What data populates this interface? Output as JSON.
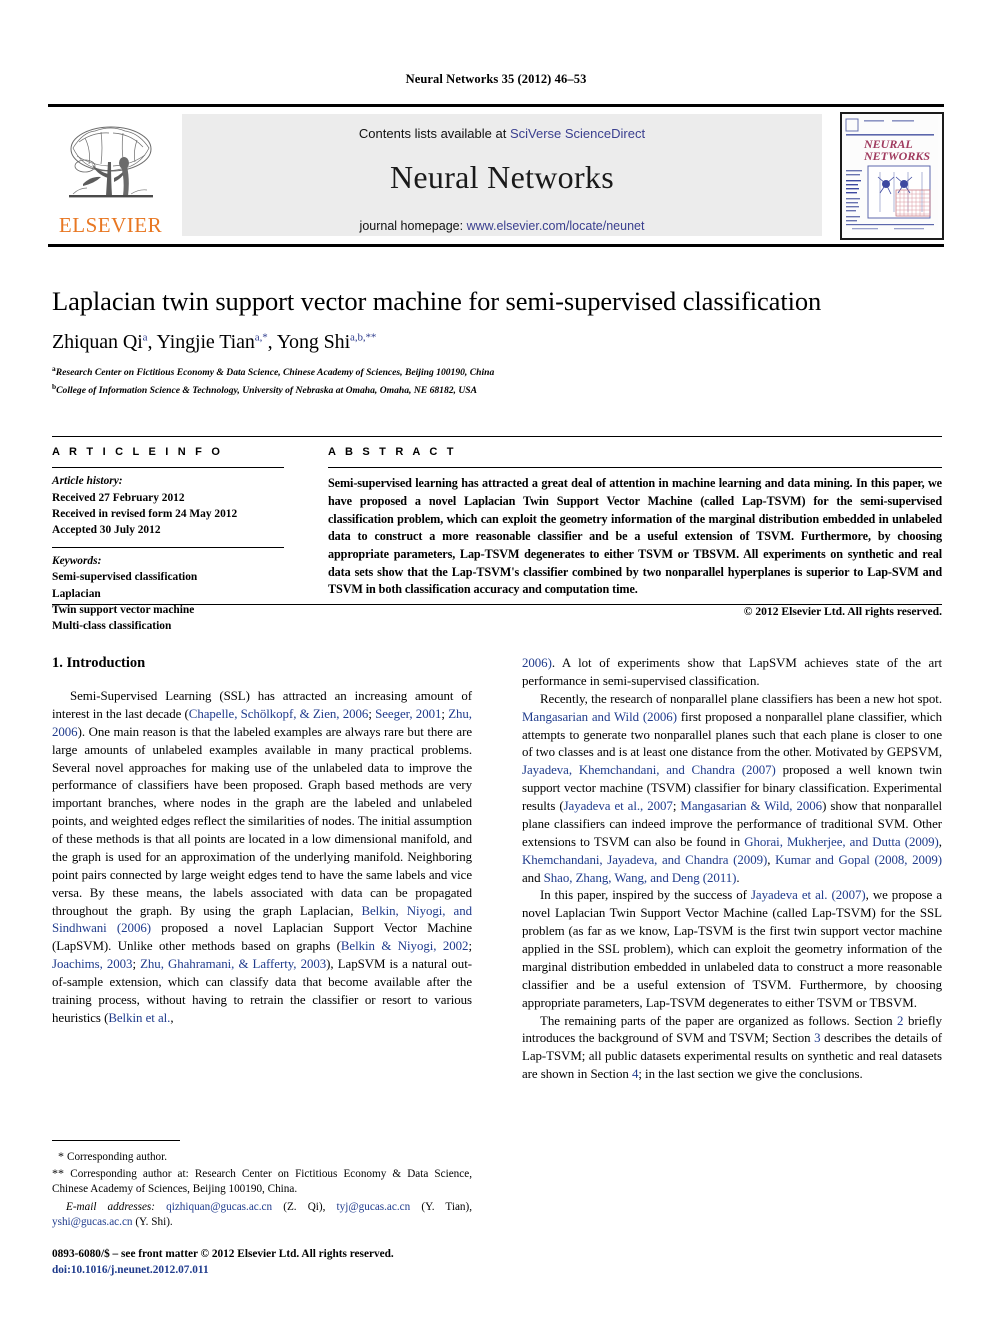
{
  "running_head": "Neural Networks 35 (2012) 46–53",
  "masthead": {
    "contents_prefix": "Contents lists available at ",
    "contents_link": "SciVerse ScienceDirect",
    "journal_name": "Neural Networks",
    "homepage_prefix": "journal homepage: ",
    "homepage_link": "www.elsevier.com/locate/neunet",
    "publisher_wordmark": "ELSEVIER",
    "cover_title_line1": "NEURAL",
    "cover_title_line2": "NETWORKS",
    "link_color": "#3a3f8f",
    "publisher_color": "#E87722"
  },
  "title": "Laplacian twin support vector machine for semi-supervised classification",
  "authors": [
    {
      "name": "Zhiquan Qi",
      "marks": "a"
    },
    {
      "name": "Yingjie Tian",
      "marks": "a,*"
    },
    {
      "name": "Yong Shi",
      "marks": "a,b,**"
    }
  ],
  "authors_line": "Zhiquan Qi",
  "affiliations": [
    {
      "mark": "a",
      "text": "Research Center on Fictitious Economy & Data Science, Chinese Academy of Sciences, Beijing 100190, China"
    },
    {
      "mark": "b",
      "text": "College of Information Science & Technology, University of Nebraska at Omaha, Omaha, NE 68182, USA"
    }
  ],
  "article_info": {
    "heading": "A R T I C L E    I N F O",
    "history_label": "Article history:",
    "history": [
      "Received 27 February 2012",
      "Received in revised form 24 May 2012",
      "Accepted 30 July 2012"
    ],
    "keywords_label": "Keywords:",
    "keywords": [
      "Semi-supervised classification",
      "Laplacian",
      "Twin support vector machine",
      "Multi-class classification"
    ]
  },
  "abstract": {
    "heading": "A B S T R A C T",
    "text": "Semi-supervised learning has attracted a great deal of attention in machine learning and data mining. In this paper, we have proposed a novel Laplacian Twin Support Vector Machine (called Lap-TSVM) for the semi-supervised classification problem, which can exploit the geometry information of the marginal distribution embedded in unlabeled data to construct a more reasonable classifier and be a useful extension of TSVM. Furthermore, by choosing appropriate parameters, Lap-TSVM degenerates to either TSVM or TBSVM. All experiments on synthetic and real data sets show that the Lap-TSVM's classifier combined by two nonparallel hyperplanes is superior to Lap-SVM and TSVM in both classification accuracy and computation time.",
    "copyright": "© 2012 Elsevier Ltd. All rights reserved."
  },
  "body": {
    "section_title": "1. Introduction",
    "left_paragraphs": [
      "Semi-Supervised Learning (SSL) has attracted an increasing amount of interest in the last decade (Chapelle, Schölkopf, & Zien, 2006; Seeger, 2001; Zhu, 2006). One main reason is that the labeled examples are always rare but there are large amounts of unlabeled examples available in many practical problems. Several novel approaches for making use of the unlabeled data to improve the performance of classifiers have been proposed. Graph based methods are very important branches, where nodes in the graph are the labeled and unlabeled points, and weighted edges reflect the similarities of nodes. The initial assumption of these methods is that all points are located in a low dimensional manifold, and the graph is used for an approximation of the underlying manifold. Neighboring point pairs connected by large weight edges tend to have the same labels and vice versa. By these means, the labels associated with data can be propagated throughout the graph. By using the graph Laplacian, Belkin, Niyogi, and Sindhwani (2006) proposed a novel Laplacian Support Vector Machine (LapSVM). Unlike other methods based on graphs (Belkin & Niyogi, 2002; Joachims, 2003; Zhu, Ghahramani, & Lafferty, 2003), LapSVM is a natural out-of-sample extension, which can classify data that become available after the training process, without having to retrain the classifier or resort to various heuristics (Belkin et al.,"
    ],
    "right_paragraphs": [
      "2006). A lot of experiments show that LapSVM achieves state of the art performance in semi-supervised classification.",
      "Recently, the research of nonparallel plane classifiers has been a new hot spot. Mangasarian and Wild (2006) first proposed a nonparallel plane classifier, which attempts to generate two nonparallel planes such that each plane is closer to one of two classes and is at least one distance from the other. Motivated by GEPSVM, Jayadeva, Khemchandani, and Chandra (2007) proposed a well known twin support vector machine (TSVM) classifier for binary classification. Experimental results (Jayadeva et al., 2007; Mangasarian & Wild, 2006) show that nonparallel plane classifiers can indeed improve the performance of traditional SVM. Other extensions to TSVM can also be found in Ghorai, Mukherjee, and Dutta (2009), Khemchandani, Jayadeva, and Chandra (2009), Kumar and Gopal (2008, 2009) and Shao, Zhang, Wang, and Deng (2011).",
      "In this paper, inspired by the success of Jayadeva et al. (2007), we propose a novel Laplacian Twin Support Vector Machine (called Lap-TSVM) for the SSL problem (as far as we know, Lap-TSVM is the first twin support vector machine applied in the SSL problem), which can exploit the geometry information of the marginal distribution embedded in unlabeled data to construct a more reasonable classifier and be a useful extension of TSVM. Furthermore, by choosing appropriate parameters, Lap-TSVM degenerates to either TSVM or TBSVM.",
      "The remaining parts of the paper are organized as follows. Section 2 briefly introduces the background of SVM and TSVM; Section 3 describes the details of Lap-TSVM; all public datasets experimental results on synthetic and real datasets are shown in Section 4; in the last section we give the conclusions."
    ]
  },
  "footnotes": {
    "corresponding_1": "Corresponding author.",
    "corresponding_2": "Corresponding author at: Research Center on Fictitious Economy & Data Science, Chinese Academy of Sciences, Beijing 100190, China.",
    "email_label": "E-mail addresses:",
    "emails": [
      {
        "address": "qizhiquan@gucas.ac.cn",
        "person": "(Z. Qi)"
      },
      {
        "address": "tyj@gucas.ac.cn",
        "person": "(Y. Tian)"
      },
      {
        "address": "yshi@gucas.ac.cn",
        "person": "(Y. Shi)"
      }
    ],
    "issn_line": "0893-6080/$ – see front matter © 2012 Elsevier Ltd. All rights reserved.",
    "doi_line": "doi:10.1016/j.neunet.2012.07.011"
  }
}
